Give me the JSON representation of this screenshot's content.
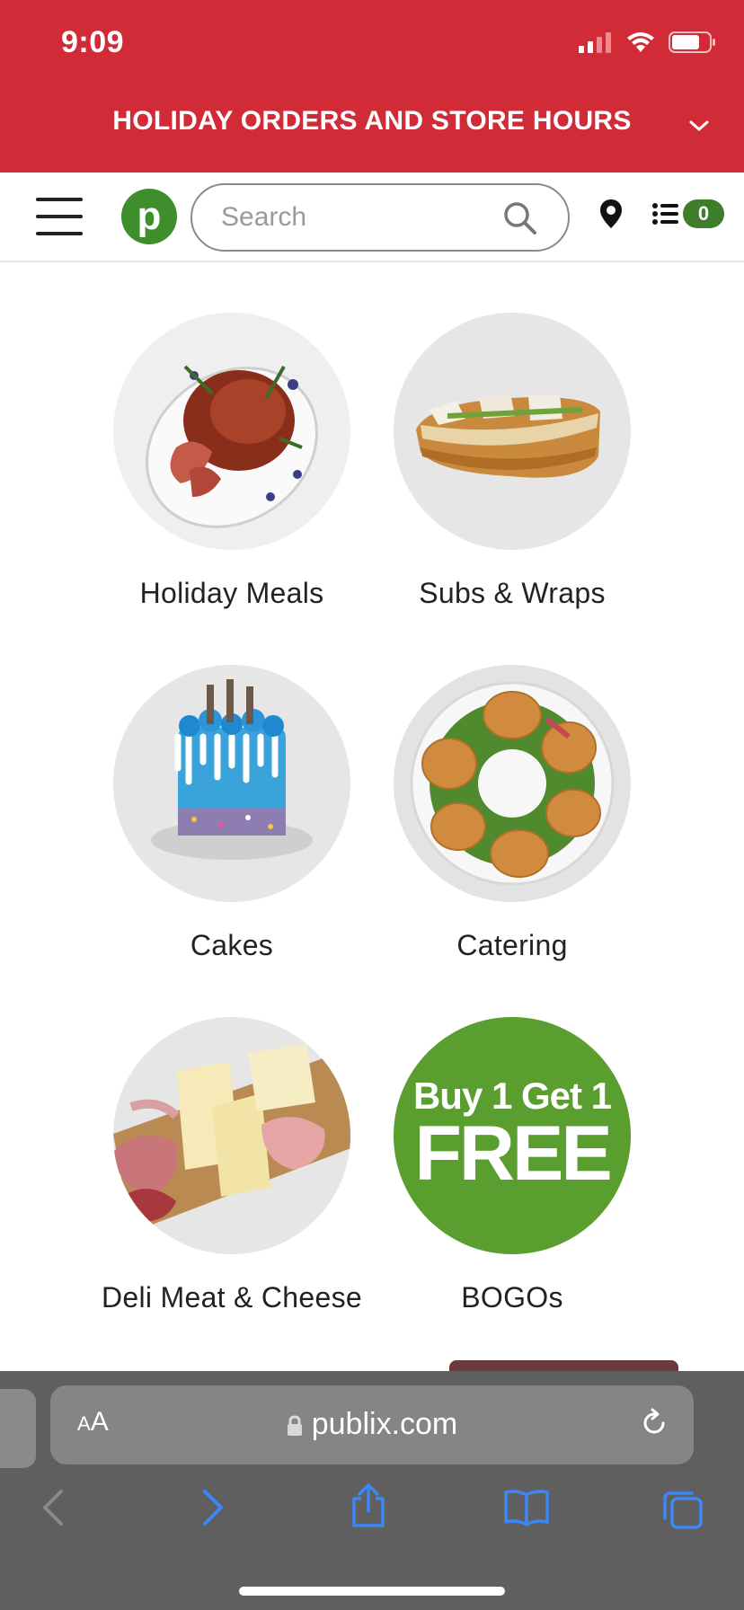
{
  "status_bar": {
    "time": "9:09"
  },
  "banner": {
    "text": "HOLIDAY ORDERS AND STORE HOURS"
  },
  "header": {
    "logo_letter": "p",
    "search_placeholder": "Search",
    "list_count": "0"
  },
  "categories": [
    {
      "label": "Holiday Meals",
      "image": "holiday-ham"
    },
    {
      "label": "Subs & Wraps",
      "image": "sub-sandwich"
    },
    {
      "label": "Cakes",
      "image": "blue-cake"
    },
    {
      "label": "Catering",
      "image": "sub-platter"
    },
    {
      "label": "Deli Meat & Cheese",
      "image": "deli-board"
    },
    {
      "label": "BOGOs",
      "image": "bogo-badge",
      "badge_line1": "Buy 1 Get 1",
      "badge_line2": "FREE"
    }
  ],
  "safari": {
    "text_size_label": "AA",
    "url": "publix.com"
  },
  "colors": {
    "brand_red": "#d22b38",
    "brand_green": "#3e8f2b",
    "bogo_green": "#5a9e2f"
  }
}
